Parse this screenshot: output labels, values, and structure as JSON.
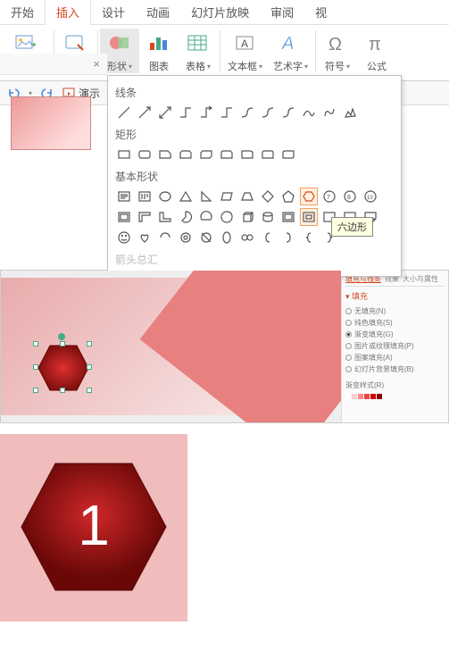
{
  "ribbon": {
    "tabs": [
      "开始",
      "插入",
      "设计",
      "动画",
      "幻灯片放映",
      "审阅",
      "视"
    ],
    "active_index": 1,
    "groups": {
      "online_pic": "在线图片",
      "screenshot": "截屏",
      "shapes": "形状",
      "chart": "图表",
      "table": "表格",
      "textbox": "文本框",
      "wordart": "艺术字",
      "symbol": "符号",
      "equation": "公式"
    },
    "qat_present": "演示"
  },
  "shapes_panel": {
    "cat_lines": "线条",
    "cat_rect": "矩形",
    "cat_basic": "基本形状",
    "cat_arrows_partial": "箭头总汇",
    "tooltip": "六边形"
  },
  "props_panel": {
    "tabs": [
      "填充与线条",
      "效果",
      "大小与属性"
    ],
    "section_fill": "▾ 填充",
    "options": [
      "无填充(N)",
      "纯色填充(S)",
      "渐变填充(G)",
      "图片或纹理填充(P)",
      "图案填充(A)",
      "幻灯片背景填充(B)"
    ],
    "gradient_label": "渐变样式(R)"
  },
  "hexagon_big_label": "1",
  "chart_data": null
}
